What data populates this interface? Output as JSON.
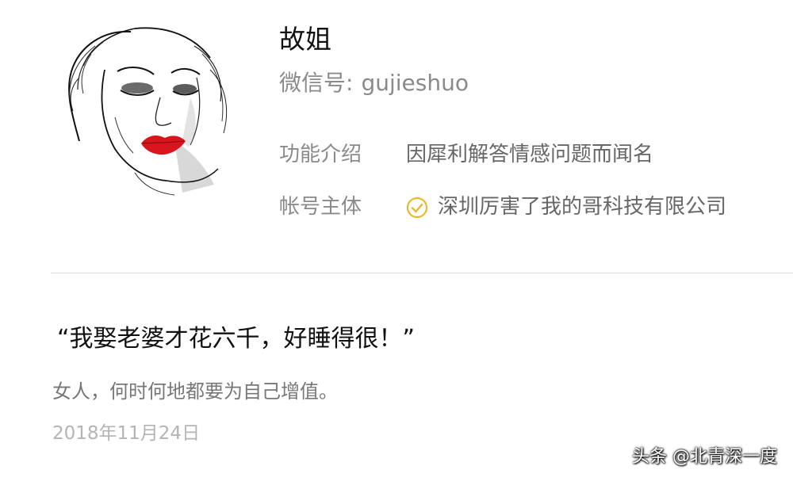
{
  "profile": {
    "name": "故姐",
    "wechat_id_label": "微信号:",
    "wechat_id": "gujieshuo",
    "function_label": "功能介绍",
    "function_value": "因犀利解答情感问题而闻名",
    "owner_label": "帐号主体",
    "owner_value": "深圳厉害了我的哥科技有限公司"
  },
  "article": {
    "title": "“我娶老婆才花六千，好睡得很！”",
    "subtitle": "女人，何时何地都要为自己增值。",
    "date": "2018年11月24日"
  },
  "watermark": "头条 @北青深一度",
  "colors": {
    "verify_badge": "#e8b92e",
    "lips": "#d8141c"
  },
  "icons": {
    "verify": "check-circle-icon"
  }
}
